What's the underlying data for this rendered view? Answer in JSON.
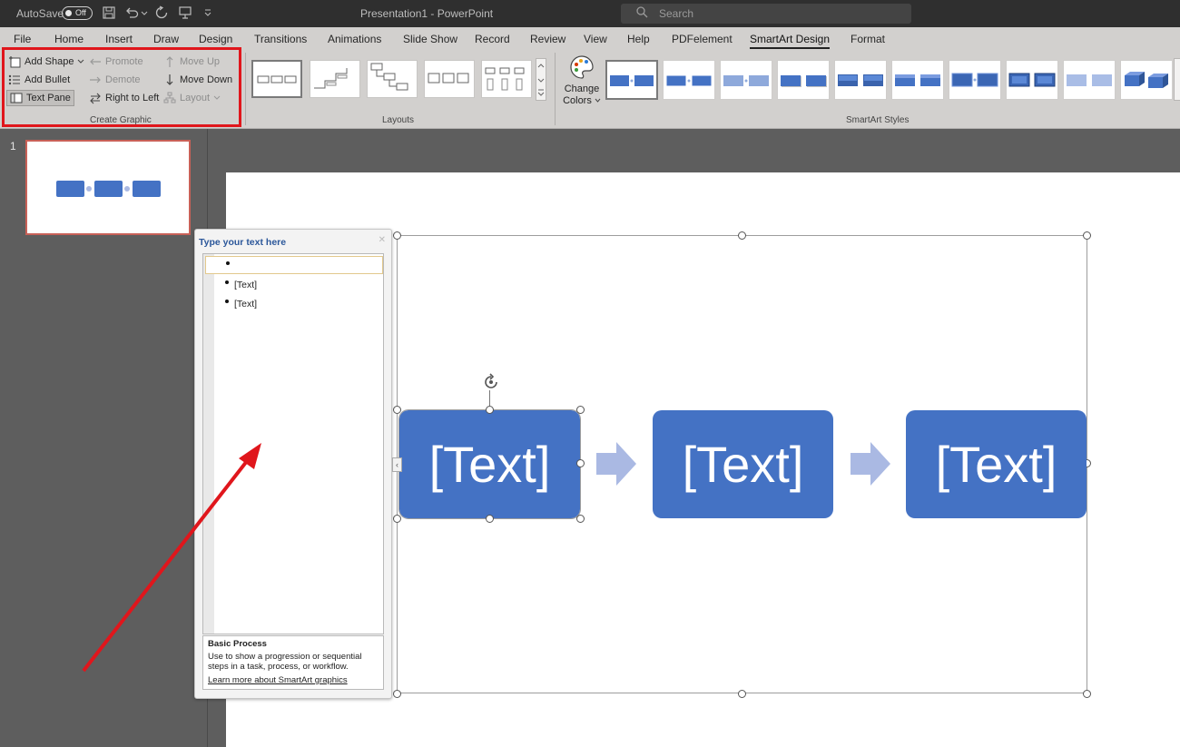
{
  "titlebar": {
    "autosave_label": "AutoSave",
    "autosave_state": "Off",
    "document_title": "Presentation1 - PowerPoint",
    "search_placeholder": "Search"
  },
  "menu": {
    "items": [
      "File",
      "Home",
      "Insert",
      "Draw",
      "Design",
      "Transitions",
      "Animations",
      "Slide Show",
      "Record",
      "Review",
      "View",
      "Help",
      "PDFelement",
      "SmartArt Design",
      "Format"
    ],
    "active": "SmartArt Design"
  },
  "ribbon": {
    "create_graphic": {
      "add_shape": "Add Shape",
      "add_bullet": "Add Bullet",
      "text_pane": "Text Pane",
      "promote": "Promote",
      "demote": "Demote",
      "right_to_left": "Right to Left",
      "move_up": "Move Up",
      "move_down": "Move Down",
      "layout": "Layout",
      "group_label": "Create Graphic"
    },
    "layouts": {
      "group_label": "Layouts"
    },
    "change_colors": {
      "line1": "Change",
      "line2": "Colors"
    },
    "smartart_styles": {
      "group_label": "SmartArt Styles"
    }
  },
  "thumbnails": {
    "slide_number": "1"
  },
  "text_pane": {
    "title": "Type your text here",
    "close": "✕",
    "items": [
      "",
      "[Text]",
      "[Text]"
    ],
    "layout_name": "Basic Process",
    "layout_description": "Use to show a progression or sequential steps in a task, process, or workflow.",
    "learn_more": "Learn more about SmartArt graphics",
    "collapse_glyph": "‹"
  },
  "smartart": {
    "shapes": [
      "[Text]",
      "[Text]",
      "[Text]"
    ],
    "fill_color": "#4472c4",
    "arrow_color": "#aab9e3"
  },
  "annotation": {
    "highlight_color": "#e0161c",
    "arrow_color": "#e0161c"
  }
}
